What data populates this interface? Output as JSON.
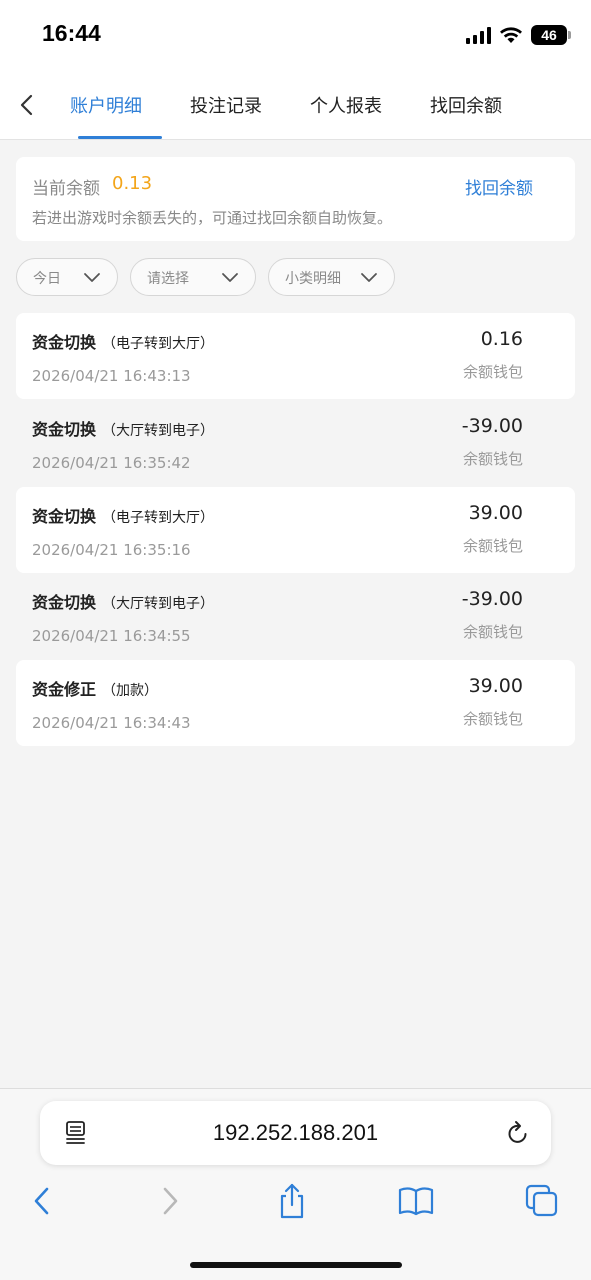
{
  "status": {
    "time": "16:44",
    "battery": "46"
  },
  "tabs": [
    {
      "label": "账户明细"
    },
    {
      "label": "投注记录"
    },
    {
      "label": "个人报表"
    },
    {
      "label": "找回余额"
    }
  ],
  "balance": {
    "label": "当前余额",
    "value": "0.13",
    "recover_label": "找回余额",
    "hint": "若进出游戏时余额丢失的，可通过找回余额自助恢复。"
  },
  "filters": [
    {
      "label": "今日"
    },
    {
      "label": "请选择"
    },
    {
      "label": "小类明细"
    }
  ],
  "records": [
    {
      "title": "资金切换",
      "sub": "（电子转到大厅）",
      "time": "2026/04/21 16:43:13",
      "amount": "0.16",
      "wallet": "余额钱包"
    },
    {
      "title": "资金切换",
      "sub": "（大厅转到电子）",
      "time": "2026/04/21 16:35:42",
      "amount": "-39.00",
      "wallet": "余额钱包"
    },
    {
      "title": "资金切换",
      "sub": "（电子转到大厅）",
      "time": "2026/04/21 16:35:16",
      "amount": "39.00",
      "wallet": "余额钱包"
    },
    {
      "title": "资金切换",
      "sub": "（大厅转到电子）",
      "time": "2026/04/21 16:34:55",
      "amount": "-39.00",
      "wallet": "余额钱包"
    },
    {
      "title": "资金修正",
      "sub": "（加款）",
      "time": "2026/04/21 16:34:43",
      "amount": "39.00",
      "wallet": "余额钱包"
    }
  ],
  "browser": {
    "url": "192.252.188.201"
  },
  "colors": {
    "accent": "#2f7fd7",
    "balance": "#f3a51a",
    "background": "#f4f4f4"
  }
}
